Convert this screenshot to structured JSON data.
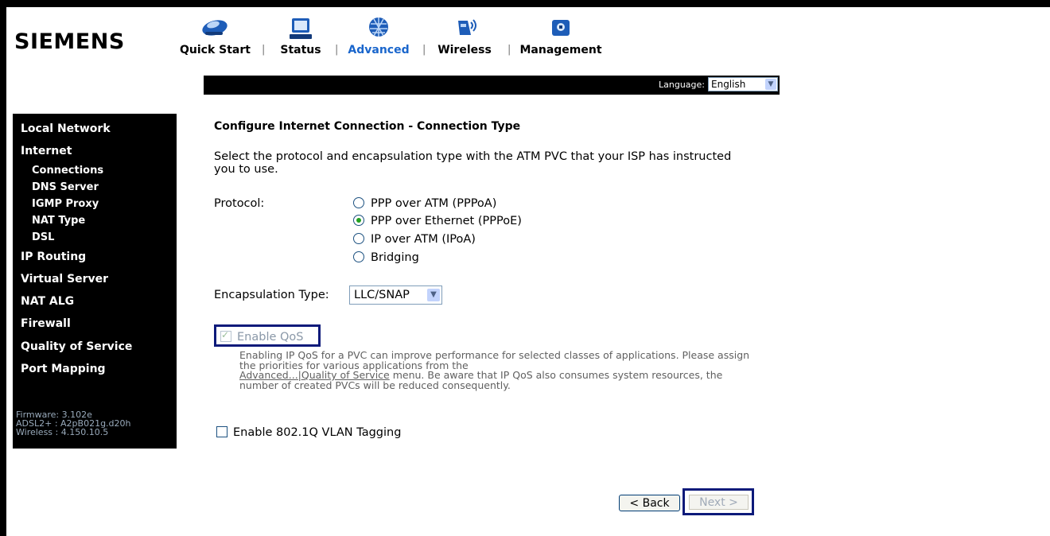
{
  "brand": "SIEMENS",
  "nav": {
    "items": [
      {
        "label": "Quick Start",
        "icon": "quick-start-icon"
      },
      {
        "label": "Status",
        "icon": "status-monitor-icon"
      },
      {
        "label": "Advanced",
        "icon": "advanced-globe-icon",
        "active": true
      },
      {
        "label": "Wireless",
        "icon": "wireless-icon"
      },
      {
        "label": "Management",
        "icon": "management-icon"
      }
    ],
    "separator": "|"
  },
  "language": {
    "label": "Language:",
    "selected": "English"
  },
  "sidebar": {
    "items": [
      "Local Network",
      "Internet",
      "IP Routing",
      "Virtual Server",
      "NAT ALG",
      "Firewall",
      "Quality of Service",
      "Port Mapping"
    ],
    "internet_sub": [
      "Connections",
      "DNS Server",
      "IGMP Proxy",
      "NAT Type",
      "DSL"
    ],
    "info": [
      "Firmware: 3.102e",
      "ADSL2+ : A2pB021g.d20h",
      "Wireless : 4.150.10.5"
    ]
  },
  "main": {
    "heading": "Configure Internet Connection - Connection Type",
    "description": "Select the protocol and encapsulation type with the ATM PVC that your ISP has instructed you to use.",
    "protocol_label": "Protocol:",
    "protocols": [
      "PPP over ATM (PPPoA)",
      "PPP over Ethernet (PPPoE)",
      "IP over ATM (IPoA)",
      "Bridging"
    ],
    "protocol_selected": "PPP over Ethernet (PPPoE)",
    "encap_label": "Encapsulation Type:",
    "encap_value": "LLC/SNAP",
    "qos_label": "Enable QoS",
    "qos_note_1": "Enabling IP QoS for a PVC can improve performance for selected classes of applications. Please assign the priorities for various applications from the",
    "qos_link": "Advanced...|Quality of Service",
    "qos_note_2": " menu. Be aware that IP QoS also consumes system resources, the number of created PVCs will be reduced consequently.",
    "vlan_label": "Enable 802.1Q VLAN Tagging",
    "back_label": "< Back",
    "next_label": "Next >"
  },
  "colors": {
    "active_nav": "#1a66cc",
    "highlight_border": "#0d1a7a",
    "sidebar_bg": "#000000"
  }
}
